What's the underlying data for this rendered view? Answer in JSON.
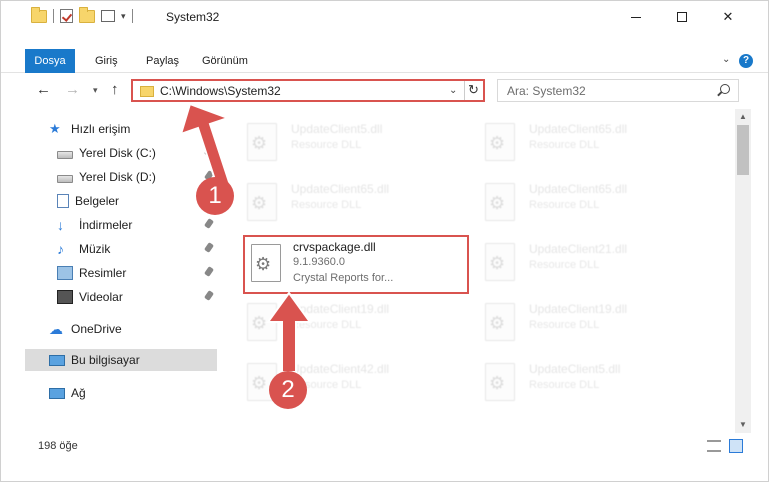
{
  "window": {
    "title": "System32",
    "controls": {
      "minimize": "minimize",
      "maximize": "maximize",
      "close": "✕"
    }
  },
  "ribbon": {
    "tabs": [
      {
        "label": "Dosya",
        "active": true
      },
      {
        "label": "Giriş"
      },
      {
        "label": "Paylaş"
      },
      {
        "label": "Görünüm"
      }
    ],
    "help": "?"
  },
  "address": {
    "path": "C:\\Windows\\System32",
    "search_placeholder": "Ara: System32"
  },
  "sidebar": {
    "items": [
      {
        "label": "Hızlı erişim",
        "icon": "star-icon"
      },
      {
        "label": "Yerel Disk (C:)",
        "icon": "drive-icon",
        "pinned": true
      },
      {
        "label": "Yerel Disk (D:)",
        "icon": "drive-icon",
        "pinned": true
      },
      {
        "label": "Belgeler",
        "icon": "document-icon",
        "pinned": true
      },
      {
        "label": "İndirmeler",
        "icon": "download-icon",
        "pinned": true
      },
      {
        "label": "Müzik",
        "icon": "music-icon",
        "pinned": true
      },
      {
        "label": "Resimler",
        "icon": "pictures-icon",
        "pinned": true
      },
      {
        "label": "Videolar",
        "icon": "video-icon",
        "pinned": true
      },
      {
        "label": "OneDrive",
        "icon": "cloud-icon"
      },
      {
        "label": "Bu bilgisayar",
        "icon": "computer-icon",
        "selected": true
      },
      {
        "label": "Ağ",
        "icon": "network-icon"
      }
    ]
  },
  "files": [
    {
      "name": "UpdateClient5.dll",
      "type": "Resource DLL"
    },
    {
      "name": "UpdateClient65.dll",
      "type": "Resource DLL"
    },
    {
      "name": "UpdateClient65.dll",
      "type": "Resource DLL"
    },
    {
      "name": "UpdateClient65.dll",
      "type": "Resource DLL"
    },
    {
      "name": "crvspackage.dll",
      "version": "9.1.9360.0",
      "type": "Crystal Reports for...",
      "highlighted": true
    },
    {
      "name": "UpdateClient21.dll",
      "type": "Resource DLL"
    },
    {
      "name": "UpdateClient19.dll",
      "type": "Resource DLL"
    },
    {
      "name": "UpdateClient19.dll",
      "type": "Resource DLL"
    },
    {
      "name": "UpdateClient42.dll",
      "type": "Resource DLL"
    },
    {
      "name": "UpdateClient5.dll",
      "type": "Resource DLL"
    }
  ],
  "status": {
    "item_count": "198 öğe"
  },
  "annotations": {
    "step1": "1",
    "step2": "2",
    "color": "#d9534f"
  }
}
